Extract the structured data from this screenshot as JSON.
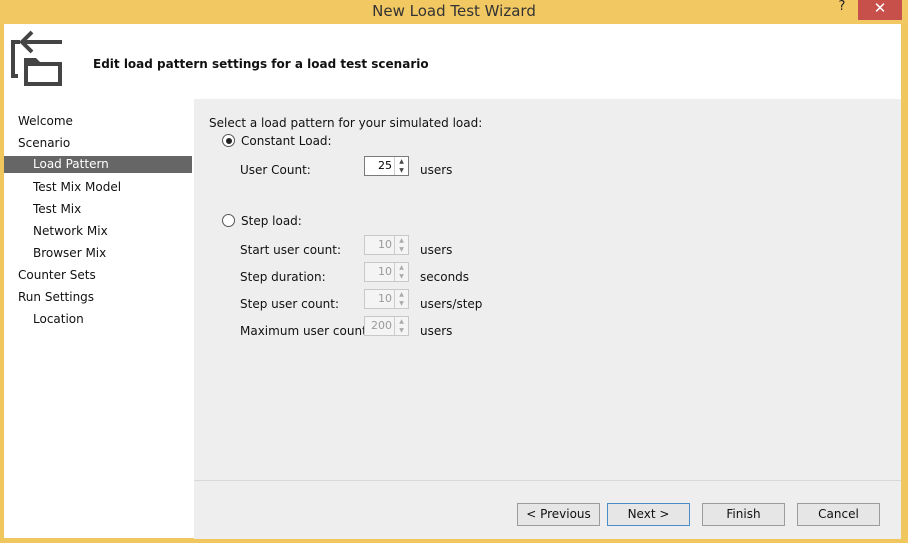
{
  "window": {
    "title": "New Load Test Wizard",
    "help_label": "?",
    "close_label": "✕"
  },
  "header": {
    "title": "Edit load pattern settings for a load test scenario",
    "icon": "wizard-folder-icon"
  },
  "nav": {
    "items": [
      {
        "label": "Welcome",
        "level": 1,
        "selected": false
      },
      {
        "label": "Scenario",
        "level": 1,
        "selected": false
      },
      {
        "label": "Load Pattern",
        "level": 2,
        "selected": true
      },
      {
        "label": "Test Mix Model",
        "level": 2,
        "selected": false
      },
      {
        "label": "Test Mix",
        "level": 2,
        "selected": false
      },
      {
        "label": "Network Mix",
        "level": 2,
        "selected": false
      },
      {
        "label": "Browser Mix",
        "level": 2,
        "selected": false
      },
      {
        "label": "Counter Sets",
        "level": 1,
        "selected": false
      },
      {
        "label": "Run Settings",
        "level": 1,
        "selected": false
      },
      {
        "label": "Location",
        "level": 2,
        "selected": false
      }
    ]
  },
  "content": {
    "prompt": "Select a load pattern for your simulated load:",
    "constant": {
      "label": "Constant Load:",
      "selected": true,
      "user_count_label": "User Count:",
      "user_count_value": "25",
      "user_count_unit": "users"
    },
    "step": {
      "label": "Step load:",
      "selected": false,
      "fields": [
        {
          "label": "Start user count:",
          "value": "10",
          "unit": "users"
        },
        {
          "label": "Step duration:",
          "value": "10",
          "unit": "seconds"
        },
        {
          "label": "Step user count:",
          "value": "10",
          "unit": "users/step"
        },
        {
          "label": "Maximum user count:",
          "value": "200",
          "unit": "users"
        }
      ]
    }
  },
  "footer": {
    "previous": "< Previous",
    "next": "Next >",
    "finish": "Finish",
    "cancel": "Cancel"
  }
}
